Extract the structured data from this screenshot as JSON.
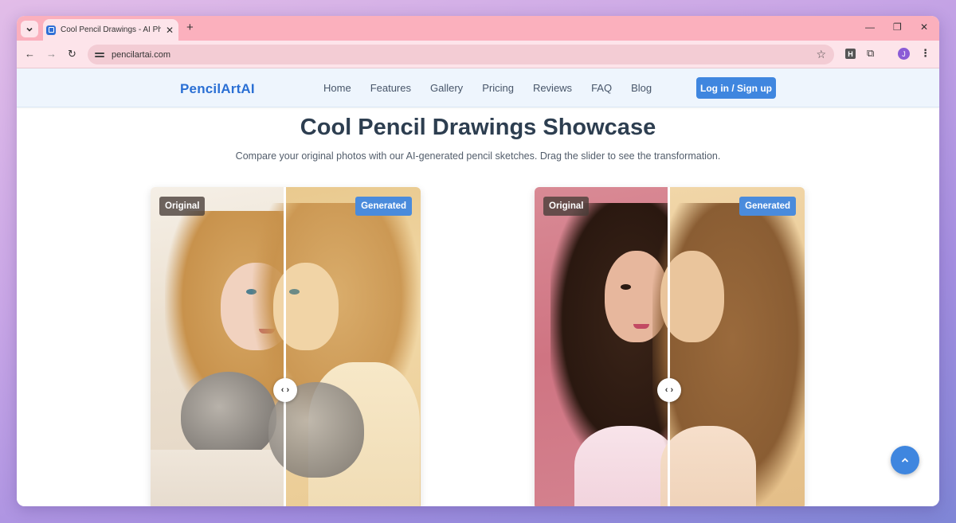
{
  "browser": {
    "tab_title": "Cool Pencil Drawings - AI Photo",
    "url": "pencilartai.com",
    "profile_initial": "J",
    "extension_letter": "H"
  },
  "header": {
    "logo": "PencilArtAI",
    "nav": [
      "Home",
      "Features",
      "Gallery",
      "Pricing",
      "Reviews",
      "FAQ",
      "Blog"
    ],
    "login_label": "Log in / Sign up"
  },
  "hero": {
    "title": "Cool Pencil Drawings Showcase",
    "subtitle": "Compare your original photos with our AI-generated pencil sketches. Drag the slider to see the transformation."
  },
  "comparisons": [
    {
      "original_label": "Original",
      "generated_label": "Generated",
      "slider_position": 0.5
    },
    {
      "original_label": "Original",
      "generated_label": "Generated",
      "slider_position": 0.5
    }
  ],
  "icons": {
    "slider_handle": "‹ ›",
    "scroll_top": "chevron-up-icon"
  }
}
